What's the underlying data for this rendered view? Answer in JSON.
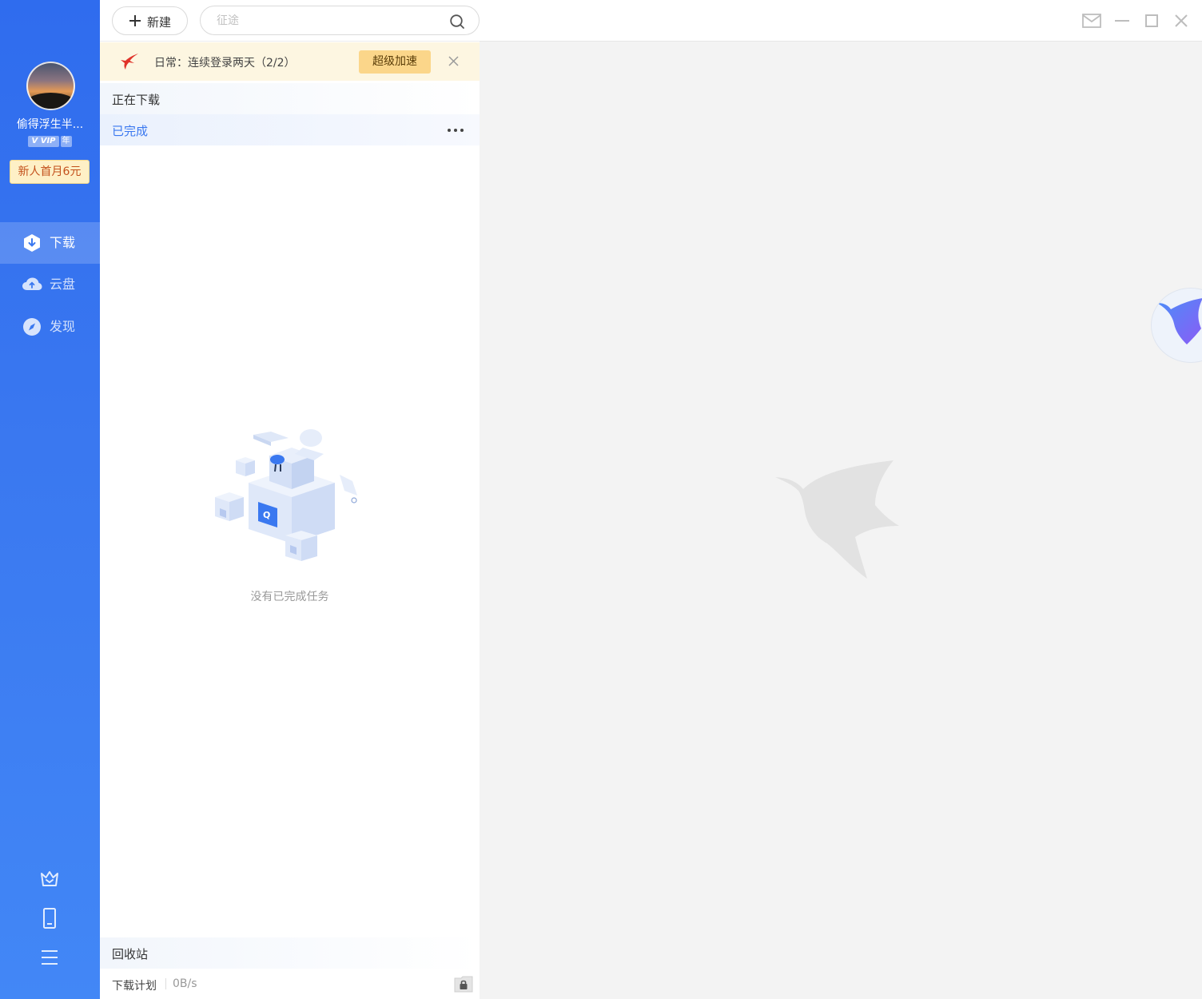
{
  "user": {
    "name": "偷得浮生半...",
    "vip_label": "VIP",
    "vip_prefix": "V",
    "year_label": "年",
    "promo": "新人首月6元"
  },
  "nav": [
    {
      "label": "下载",
      "icon": "download-icon",
      "active": true
    },
    {
      "label": "云盘",
      "icon": "cloud-icon",
      "active": false
    },
    {
      "label": "发现",
      "icon": "compass-icon",
      "active": false
    }
  ],
  "toolbar": {
    "new_label": "新建",
    "search_placeholder": "征途"
  },
  "notice": {
    "text": "日常：连续登录两天（2/2）",
    "action": "超级加速"
  },
  "tabs": {
    "downloading": "正在下载",
    "completed": "已完成"
  },
  "empty": {
    "text": "没有已完成任务"
  },
  "footer": {
    "recycle": "回收站",
    "plan": "下载计划",
    "speed": "0B/s"
  },
  "colors": {
    "sidebar": "#3a78f0",
    "accent": "#3a78f0",
    "notice_bg": "#fdf6e1",
    "boost_bg": "#fbd68a",
    "promo_text": "#c3501b"
  }
}
